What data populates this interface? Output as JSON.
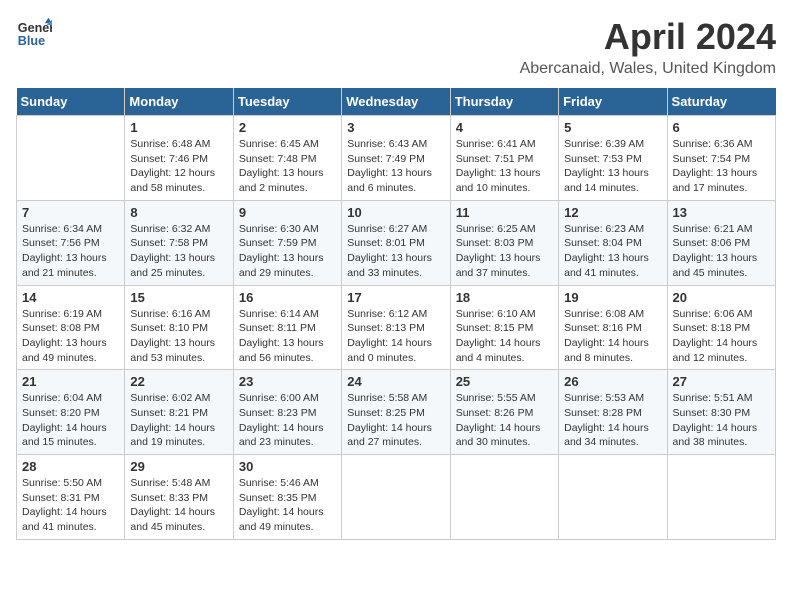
{
  "header": {
    "logo_line1": "General",
    "logo_line2": "Blue",
    "month": "April 2024",
    "location": "Abercanaid, Wales, United Kingdom"
  },
  "days_of_week": [
    "Sunday",
    "Monday",
    "Tuesday",
    "Wednesday",
    "Thursday",
    "Friday",
    "Saturday"
  ],
  "weeks": [
    [
      {
        "day": "",
        "info": ""
      },
      {
        "day": "1",
        "info": "Sunrise: 6:48 AM\nSunset: 7:46 PM\nDaylight: 12 hours\nand 58 minutes."
      },
      {
        "day": "2",
        "info": "Sunrise: 6:45 AM\nSunset: 7:48 PM\nDaylight: 13 hours\nand 2 minutes."
      },
      {
        "day": "3",
        "info": "Sunrise: 6:43 AM\nSunset: 7:49 PM\nDaylight: 13 hours\nand 6 minutes."
      },
      {
        "day": "4",
        "info": "Sunrise: 6:41 AM\nSunset: 7:51 PM\nDaylight: 13 hours\nand 10 minutes."
      },
      {
        "day": "5",
        "info": "Sunrise: 6:39 AM\nSunset: 7:53 PM\nDaylight: 13 hours\nand 14 minutes."
      },
      {
        "day": "6",
        "info": "Sunrise: 6:36 AM\nSunset: 7:54 PM\nDaylight: 13 hours\nand 17 minutes."
      }
    ],
    [
      {
        "day": "7",
        "info": "Sunrise: 6:34 AM\nSunset: 7:56 PM\nDaylight: 13 hours\nand 21 minutes."
      },
      {
        "day": "8",
        "info": "Sunrise: 6:32 AM\nSunset: 7:58 PM\nDaylight: 13 hours\nand 25 minutes."
      },
      {
        "day": "9",
        "info": "Sunrise: 6:30 AM\nSunset: 7:59 PM\nDaylight: 13 hours\nand 29 minutes."
      },
      {
        "day": "10",
        "info": "Sunrise: 6:27 AM\nSunset: 8:01 PM\nDaylight: 13 hours\nand 33 minutes."
      },
      {
        "day": "11",
        "info": "Sunrise: 6:25 AM\nSunset: 8:03 PM\nDaylight: 13 hours\nand 37 minutes."
      },
      {
        "day": "12",
        "info": "Sunrise: 6:23 AM\nSunset: 8:04 PM\nDaylight: 13 hours\nand 41 minutes."
      },
      {
        "day": "13",
        "info": "Sunrise: 6:21 AM\nSunset: 8:06 PM\nDaylight: 13 hours\nand 45 minutes."
      }
    ],
    [
      {
        "day": "14",
        "info": "Sunrise: 6:19 AM\nSunset: 8:08 PM\nDaylight: 13 hours\nand 49 minutes."
      },
      {
        "day": "15",
        "info": "Sunrise: 6:16 AM\nSunset: 8:10 PM\nDaylight: 13 hours\nand 53 minutes."
      },
      {
        "day": "16",
        "info": "Sunrise: 6:14 AM\nSunset: 8:11 PM\nDaylight: 13 hours\nand 56 minutes."
      },
      {
        "day": "17",
        "info": "Sunrise: 6:12 AM\nSunset: 8:13 PM\nDaylight: 14 hours\nand 0 minutes."
      },
      {
        "day": "18",
        "info": "Sunrise: 6:10 AM\nSunset: 8:15 PM\nDaylight: 14 hours\nand 4 minutes."
      },
      {
        "day": "19",
        "info": "Sunrise: 6:08 AM\nSunset: 8:16 PM\nDaylight: 14 hours\nand 8 minutes."
      },
      {
        "day": "20",
        "info": "Sunrise: 6:06 AM\nSunset: 8:18 PM\nDaylight: 14 hours\nand 12 minutes."
      }
    ],
    [
      {
        "day": "21",
        "info": "Sunrise: 6:04 AM\nSunset: 8:20 PM\nDaylight: 14 hours\nand 15 minutes."
      },
      {
        "day": "22",
        "info": "Sunrise: 6:02 AM\nSunset: 8:21 PM\nDaylight: 14 hours\nand 19 minutes."
      },
      {
        "day": "23",
        "info": "Sunrise: 6:00 AM\nSunset: 8:23 PM\nDaylight: 14 hours\nand 23 minutes."
      },
      {
        "day": "24",
        "info": "Sunrise: 5:58 AM\nSunset: 8:25 PM\nDaylight: 14 hours\nand 27 minutes."
      },
      {
        "day": "25",
        "info": "Sunrise: 5:55 AM\nSunset: 8:26 PM\nDaylight: 14 hours\nand 30 minutes."
      },
      {
        "day": "26",
        "info": "Sunrise: 5:53 AM\nSunset: 8:28 PM\nDaylight: 14 hours\nand 34 minutes."
      },
      {
        "day": "27",
        "info": "Sunrise: 5:51 AM\nSunset: 8:30 PM\nDaylight: 14 hours\nand 38 minutes."
      }
    ],
    [
      {
        "day": "28",
        "info": "Sunrise: 5:50 AM\nSunset: 8:31 PM\nDaylight: 14 hours\nand 41 minutes."
      },
      {
        "day": "29",
        "info": "Sunrise: 5:48 AM\nSunset: 8:33 PM\nDaylight: 14 hours\nand 45 minutes."
      },
      {
        "day": "30",
        "info": "Sunrise: 5:46 AM\nSunset: 8:35 PM\nDaylight: 14 hours\nand 49 minutes."
      },
      {
        "day": "",
        "info": ""
      },
      {
        "day": "",
        "info": ""
      },
      {
        "day": "",
        "info": ""
      },
      {
        "day": "",
        "info": ""
      }
    ]
  ]
}
